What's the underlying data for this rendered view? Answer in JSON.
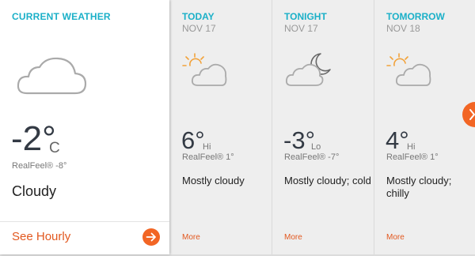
{
  "current": {
    "title": "CURRENT WEATHER",
    "icon": "cloud-icon",
    "temp": "-2°",
    "unit": "C",
    "realfeel": "RealFeel® -8°",
    "condition": "Cloudy",
    "see_hourly": "See Hourly"
  },
  "forecast": [
    {
      "title": "TODAY",
      "date": "NOV 17",
      "icon": "partly-cloudy-day-icon",
      "temp": "6°",
      "temp_label": "Hi",
      "realfeel": "RealFeel® 1°",
      "phrase": "Mostly cloudy",
      "more": "More"
    },
    {
      "title": "TONIGHT",
      "date": "NOV 17",
      "icon": "partly-cloudy-night-icon",
      "temp": "-3°",
      "temp_label": "Lo",
      "realfeel": "RealFeel® -7°",
      "phrase": "Mostly cloudy; cold",
      "more": "More"
    },
    {
      "title": "TOMORROW",
      "date": "NOV 18",
      "icon": "partly-cloudy-day-icon",
      "temp": "4°",
      "temp_label": "Hi",
      "realfeel": "RealFeel® 1°",
      "phrase": "Mostly cloudy; chilly",
      "more": "More"
    }
  ],
  "colors": {
    "accent_teal": "#1bb0c8",
    "accent_orange": "#f26524",
    "background": "#eeeeee"
  }
}
